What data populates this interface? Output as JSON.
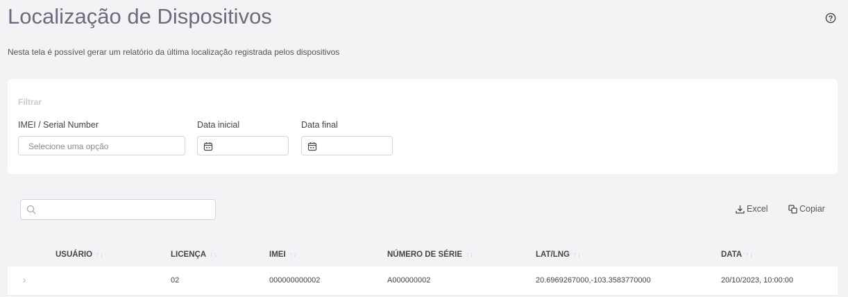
{
  "header": {
    "title": "Localização de Dispositivos",
    "subtitle": "Nesta tela é possível gerar um relatório da última localização registrada pelos dispositivos",
    "help_icon": "help-circle-icon"
  },
  "filter": {
    "title": "Filtrar",
    "imei_label": "IMEI / Serial Number",
    "imei_placeholder": "Selecione uma opção",
    "start_label": "Data inicial",
    "end_label": "Data final",
    "calendar_icon": "calendar-icon"
  },
  "toolbar": {
    "search_icon": "search-icon",
    "excel_label": "Excel",
    "copy_label": "Copiar"
  },
  "table": {
    "columns": [
      "USUÁRIO",
      "LICENÇA",
      "IMEI",
      "NÚMERO DE SÉRIE",
      "LAT/LNG",
      "DATA"
    ],
    "rows": [
      {
        "usuario": "",
        "licenca": "02",
        "imei": "000000000002",
        "serie": "A000000002",
        "latlng": "20.6969267000,-103.3583770000",
        "data": "20/10/2023, 10:00:00"
      }
    ]
  },
  "colors": {
    "background": "#f3f3f6",
    "card": "#ffffff",
    "title": "#6b6b7b"
  }
}
